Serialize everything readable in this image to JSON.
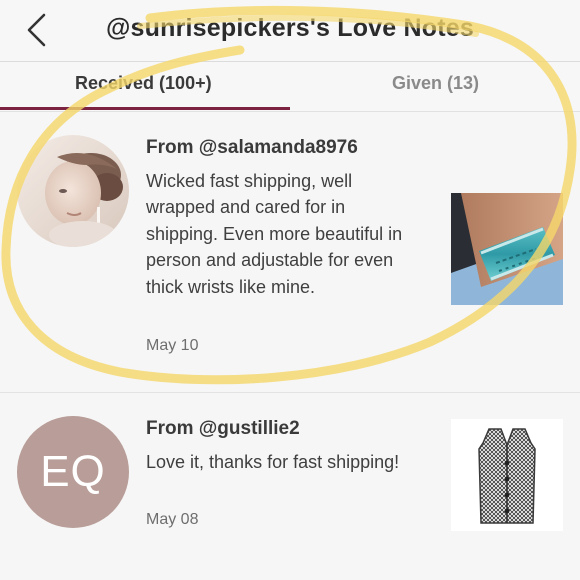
{
  "header": {
    "title": "@sunrisepickers's Love Notes",
    "back_icon": "chevron-left-icon"
  },
  "tabs": [
    {
      "label": "Received (100+)",
      "active": true
    },
    {
      "label": "Given (13)",
      "active": false
    }
  ],
  "notes": [
    {
      "from": "From @salamanda8976",
      "message": "Wicked fast shipping, well wrapped and cared for in shipping. Even more beautiful in person and adjustable for even thick wrists like mine.",
      "date": "May 10",
      "avatar_type": "photo",
      "thumbnail": "turquoise-cuff-bracelet"
    },
    {
      "from": "From @gustillie2",
      "message": "Love it, thanks for fast shipping!",
      "date": "May 08",
      "avatar_type": "initials",
      "initials": "EQ",
      "avatar_color": "#b89d98",
      "thumbnail": "houndstooth-vest"
    }
  ],
  "colors": {
    "accent": "#7b2341",
    "highlight_scribble": "#f5d76a"
  }
}
